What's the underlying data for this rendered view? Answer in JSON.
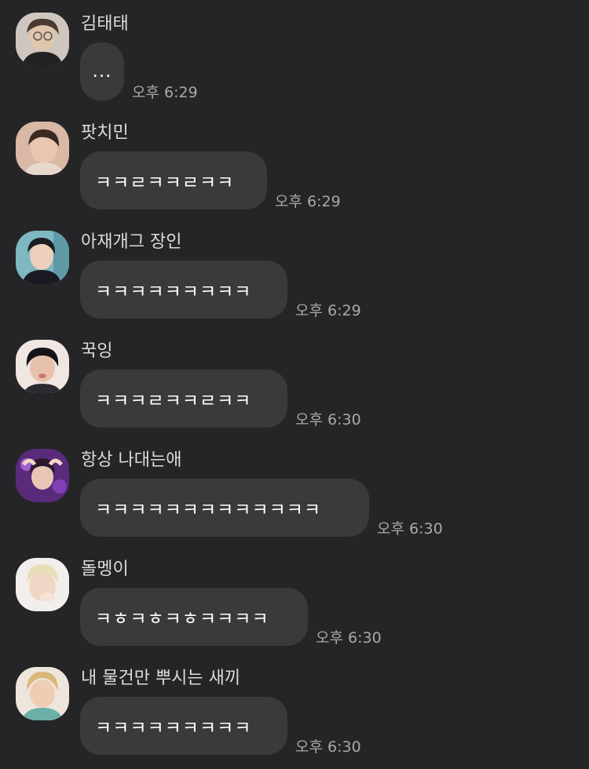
{
  "messages": [
    {
      "sender": "김태태",
      "text": "...",
      "time": "오후 6:29"
    },
    {
      "sender": "팟치민",
      "text": "ㅋㅋㄹㅋㅋㄹㅋㅋ",
      "time": "오후 6:29"
    },
    {
      "sender": "아재개그 장인",
      "text": "ㅋㅋㅋㅋㅋㅋㅋㅋㅋ",
      "time": "오후 6:29"
    },
    {
      "sender": "꾹잉",
      "text": "ㅋㅋㅋㄹㅋㅋㄹㅋㅋ",
      "time": "오후 6:30"
    },
    {
      "sender": "항상 나대는애",
      "text": "ㅋㅋㅋㅋㅋㅋㅋㅋㅋㅋㅋㅋㅋ",
      "time": "오후 6:30"
    },
    {
      "sender": "돌멩이",
      "text": "ㅋㅎㅋㅎㅋㅎㅋㅋㅋㅋ",
      "time": "오후 6:30"
    },
    {
      "sender": "내 물건만 뿌시는 새끼",
      "text": "ㅋㅋㅋㅋㅋㅋㅋㅋㅋ",
      "time": "오후 6:30"
    }
  ],
  "avatar_icons": [
    "profile-photo-icon",
    "profile-photo-icon",
    "profile-photo-icon",
    "profile-photo-icon",
    "profile-photo-icon",
    "profile-photo-icon",
    "profile-photo-icon"
  ],
  "colors": {
    "background": "#252528",
    "bubble": "#3a3a3d",
    "sender_name": "#dcdcdc",
    "message_text": "#ffffff",
    "timestamp": "#a9a9a9"
  }
}
